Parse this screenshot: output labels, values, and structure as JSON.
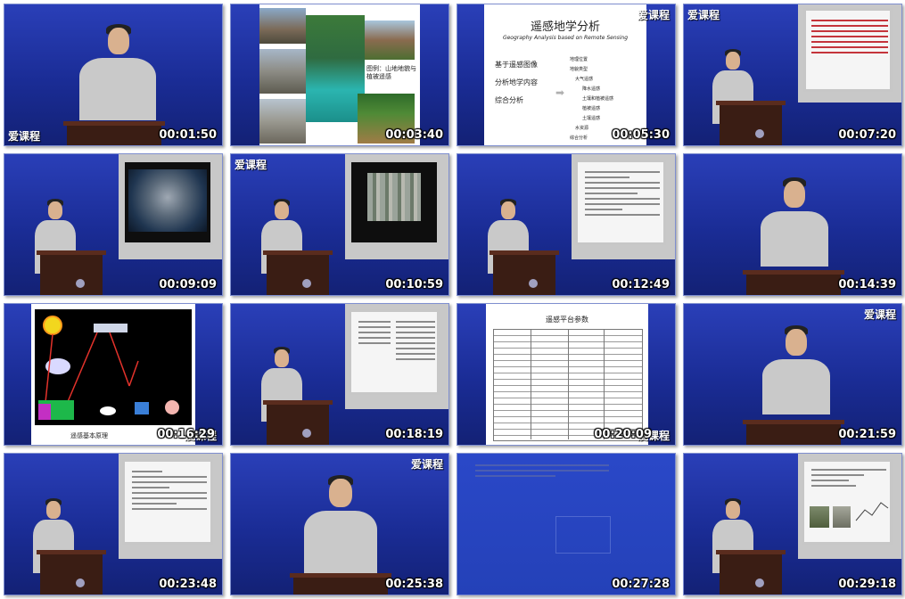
{
  "watermark": "爱课程",
  "thumbnails": [
    {
      "time": "00:01:50"
    },
    {
      "time": "00:03:40"
    },
    {
      "time": "00:05:30"
    },
    {
      "time": "00:07:20"
    },
    {
      "time": "00:09:09"
    },
    {
      "time": "00:10:59"
    },
    {
      "time": "00:12:49"
    },
    {
      "time": "00:14:39"
    },
    {
      "time": "00:16:29"
    },
    {
      "time": "00:18:19"
    },
    {
      "time": "00:20:09"
    },
    {
      "time": "00:21:59"
    },
    {
      "time": "00:23:48"
    },
    {
      "time": "00:25:38"
    },
    {
      "time": "00:27:28"
    },
    {
      "time": "00:29:18"
    }
  ],
  "slides": {
    "geography": {
      "title": "遥感地学分析",
      "subtitle": "Geography Analysis based on Remote Sensing",
      "left_items": [
        "基于遥感图像",
        "分析地学内容",
        "综合分析"
      ],
      "right_items": [
        "地理位置",
        "地貌类型",
        "大气遥感",
        "降水遥感",
        "土壤和植被遥感",
        "植被遥感",
        "土壤遥感",
        "水资源",
        "综合分析"
      ]
    },
    "photo_caption": "图例：山地地貌与植被遥感",
    "diagram_caption": "遥感基本原理",
    "table_title": "遥感平台参数"
  }
}
